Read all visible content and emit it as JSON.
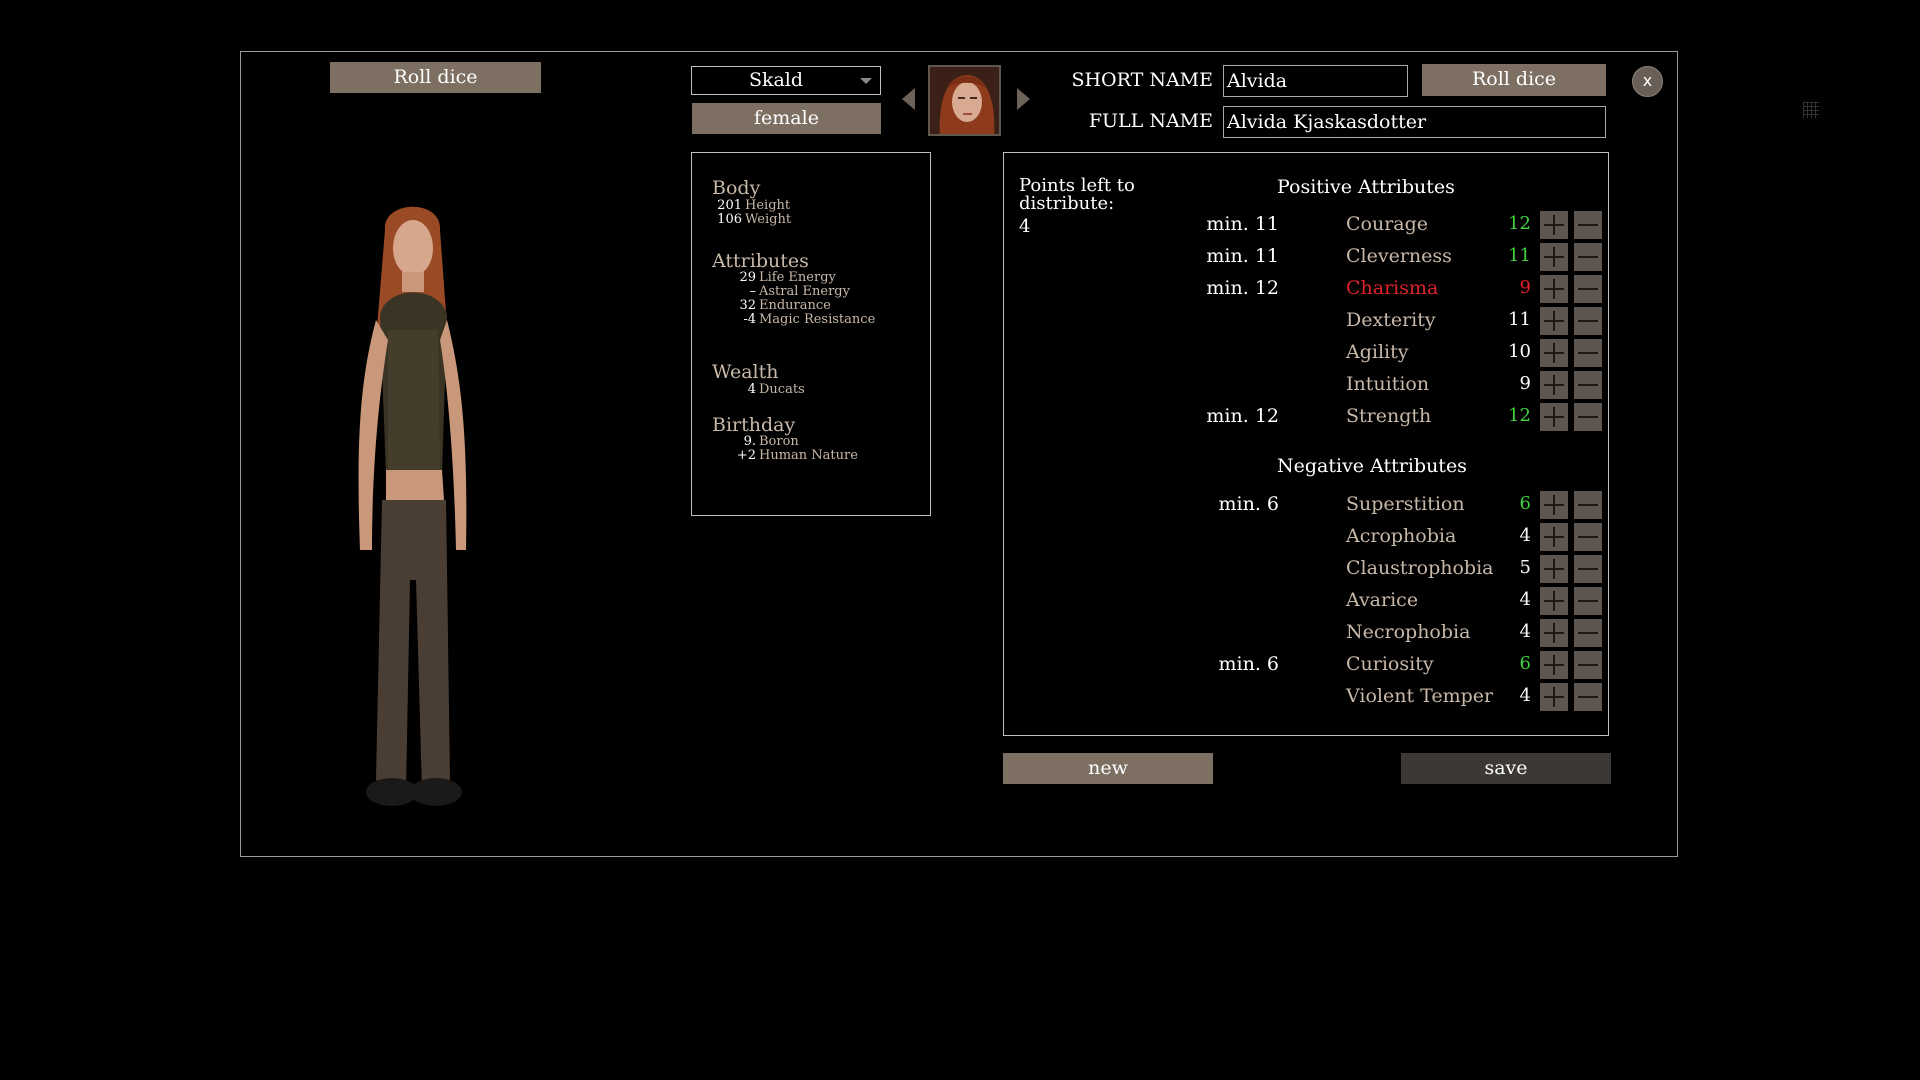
{
  "header": {
    "left_roll_label": "Roll dice",
    "class_value": "Skald",
    "gender_label": "female",
    "right_roll_label": "Roll dice",
    "close_label": "x"
  },
  "names": {
    "short_label": "SHORT NAME",
    "short_value": "Alvida",
    "full_label": "FULL NAME",
    "full_value": "Alvida Kjaskasdotter"
  },
  "stats": {
    "body_title": "Body",
    "height_num": "201",
    "height_label": "Height",
    "weight_num": "106",
    "weight_label": "Weight",
    "attributes_title": "Attributes",
    "life_num": "29",
    "life_label": "Life Energy",
    "astral_num": "–",
    "astral_label": "Astral Energy",
    "endurance_num": "32",
    "endurance_label": "Endurance",
    "magic_num": "-4",
    "magic_label": "Magic Resistance",
    "wealth_title": "Wealth",
    "ducats_num": "4",
    "ducats_label": "Ducats",
    "birthday_title": "Birthday",
    "boron_num": "9.",
    "boron_label": "Boron",
    "nature_num": "+2",
    "nature_label": "Human Nature"
  },
  "attributes": {
    "points_label": "Points left to distribute:",
    "points_value": "4",
    "positive_title": "Positive Attributes",
    "negative_title": "Negative Attributes",
    "positive": [
      {
        "min": "min. 11",
        "name": "Courage",
        "value": "12",
        "state": "green"
      },
      {
        "min": "min. 11",
        "name": "Cleverness",
        "value": "11",
        "state": "green"
      },
      {
        "min": "min. 12",
        "name": "Charisma",
        "value": "9",
        "state": "red"
      },
      {
        "min": "",
        "name": "Dexterity",
        "value": "11",
        "state": "normal"
      },
      {
        "min": "",
        "name": "Agility",
        "value": "10",
        "state": "normal"
      },
      {
        "min": "",
        "name": "Intuition",
        "value": "9",
        "state": "normal"
      },
      {
        "min": "min. 12",
        "name": "Strength",
        "value": "12",
        "state": "green"
      }
    ],
    "negative": [
      {
        "min": "min. 6",
        "name": "Superstition",
        "value": "6",
        "state": "green"
      },
      {
        "min": "",
        "name": "Acrophobia",
        "value": "4",
        "state": "normal"
      },
      {
        "min": "",
        "name": "Claustrophobia",
        "value": "5",
        "state": "normal"
      },
      {
        "min": "",
        "name": "Avarice",
        "value": "4",
        "state": "normal"
      },
      {
        "min": "",
        "name": "Necrophobia",
        "value": "4",
        "state": "normal"
      },
      {
        "min": "min. 6",
        "name": "Curiosity",
        "value": "6",
        "state": "green"
      },
      {
        "min": "",
        "name": "Violent Temper",
        "value": "4",
        "state": "normal"
      }
    ]
  },
  "footer": {
    "new_label": "new",
    "save_label": "save"
  },
  "colors": {
    "button": "#7d7062",
    "label_tan": "#c8b8a8",
    "ok_green": "#3fd23f",
    "warn_red": "#e0202a"
  }
}
